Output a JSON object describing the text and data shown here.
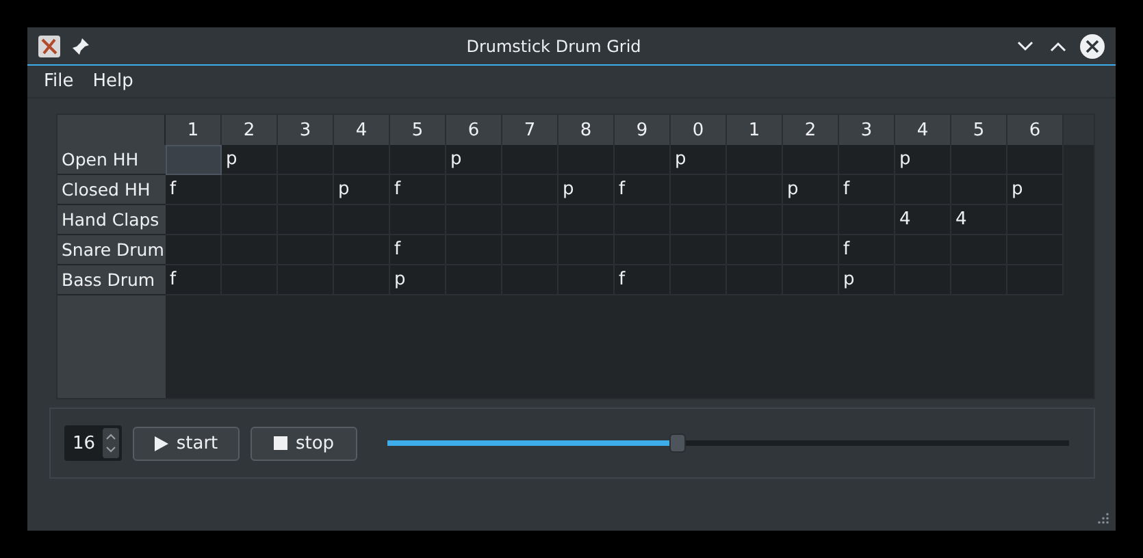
{
  "window": {
    "title": "Drumstick Drum Grid"
  },
  "menu": [
    "File",
    "Help"
  ],
  "grid": {
    "columns": [
      "1",
      "2",
      "3",
      "4",
      "5",
      "6",
      "7",
      "8",
      "9",
      "0",
      "1",
      "2",
      "3",
      "4",
      "5",
      "6"
    ],
    "rows": [
      {
        "name": "Open HH",
        "cells": [
          {
            "selected": true
          },
          {
            "text": "p",
            "selected": false
          },
          {
            "selected": false
          },
          {
            "selected": false
          },
          {
            "selected": false
          },
          {
            "text": "p",
            "selected": false
          },
          {
            "selected": false
          },
          {
            "selected": false
          },
          {
            "selected": false
          },
          {
            "text": "p",
            "selected": false
          },
          {
            "selected": false
          },
          {
            "selected": false
          },
          {
            "selected": false
          },
          {
            "text": "p",
            "selected": false
          },
          {
            "selected": false
          },
          {
            "selected": false
          }
        ]
      },
      {
        "name": "Closed HH",
        "cells": [
          {
            "text": "f",
            "selected": false
          },
          {
            "selected": false
          },
          {
            "selected": false
          },
          {
            "text": "p",
            "selected": false
          },
          {
            "text": "f",
            "selected": false
          },
          {
            "selected": false
          },
          {
            "selected": false
          },
          {
            "text": "p",
            "selected": false
          },
          {
            "text": "f",
            "selected": false
          },
          {
            "selected": false
          },
          {
            "selected": false
          },
          {
            "text": "p",
            "selected": false
          },
          {
            "text": "f",
            "selected": false
          },
          {
            "selected": false
          },
          {
            "selected": false
          },
          {
            "text": "p",
            "selected": false
          }
        ]
      },
      {
        "name": "Hand Claps",
        "cells": [
          {
            "selected": false
          },
          {
            "selected": false
          },
          {
            "selected": false
          },
          {
            "selected": false
          },
          {
            "selected": false
          },
          {
            "selected": false
          },
          {
            "selected": false
          },
          {
            "selected": false
          },
          {
            "selected": false
          },
          {
            "selected": false
          },
          {
            "selected": false
          },
          {
            "selected": false
          },
          {
            "selected": false
          },
          {
            "text": "4",
            "selected": false
          },
          {
            "text": "4",
            "selected": false
          },
          {
            "selected": false
          }
        ]
      },
      {
        "name": "Snare Drum",
        "cells": [
          {
            "selected": false
          },
          {
            "selected": false
          },
          {
            "selected": false
          },
          {
            "selected": false
          },
          {
            "text": "f",
            "selected": false
          },
          {
            "selected": false
          },
          {
            "selected": false
          },
          {
            "selected": false
          },
          {
            "selected": false
          },
          {
            "selected": false
          },
          {
            "selected": false
          },
          {
            "selected": false
          },
          {
            "text": "f",
            "selected": false
          },
          {
            "selected": false
          },
          {
            "selected": false
          },
          {
            "selected": false
          }
        ]
      },
      {
        "name": "Bass Drum",
        "cells": [
          {
            "text": "f",
            "selected": false
          },
          {
            "selected": false
          },
          {
            "selected": false
          },
          {
            "selected": false
          },
          {
            "text": "p",
            "selected": false
          },
          {
            "selected": false
          },
          {
            "selected": false
          },
          {
            "selected": false
          },
          {
            "text": "f",
            "selected": false
          },
          {
            "selected": false
          },
          {
            "selected": false
          },
          {
            "selected": false
          },
          {
            "text": "p",
            "selected": false
          },
          {
            "selected": false
          },
          {
            "selected": false
          },
          {
            "selected": false
          }
        ]
      }
    ]
  },
  "controls": {
    "steps": "16",
    "start": "start",
    "stop": "stop",
    "tempo": {
      "level": 0.425
    }
  }
}
